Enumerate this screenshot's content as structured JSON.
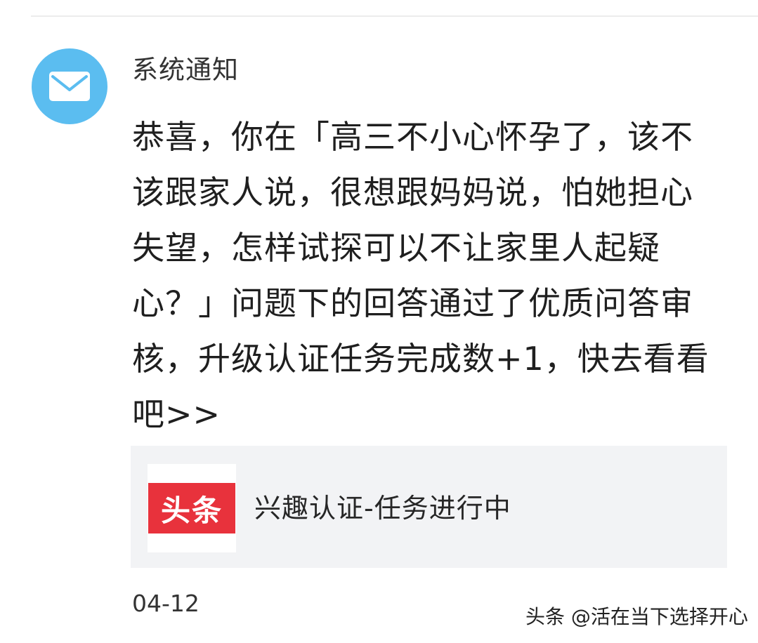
{
  "notification": {
    "sender": "系统通知",
    "avatar_icon": "mail-envelope-icon",
    "avatar_color": "#5bbdf0",
    "message": "恭喜，你在「高三不小心怀孕了，该不该跟家人说，很想跟妈妈说，怕她担心失望，怎样试探可以不让家里人起疑心？」问题下的回答通过了优质问答审核，升级认证任务完成数+1，快去看看吧>>",
    "card": {
      "logo_text": "头条",
      "logo_color": "#e8323c",
      "title": "兴趣认证-任务进行中"
    },
    "date": "04-12"
  },
  "watermark": "头条 @活在当下选择开心"
}
